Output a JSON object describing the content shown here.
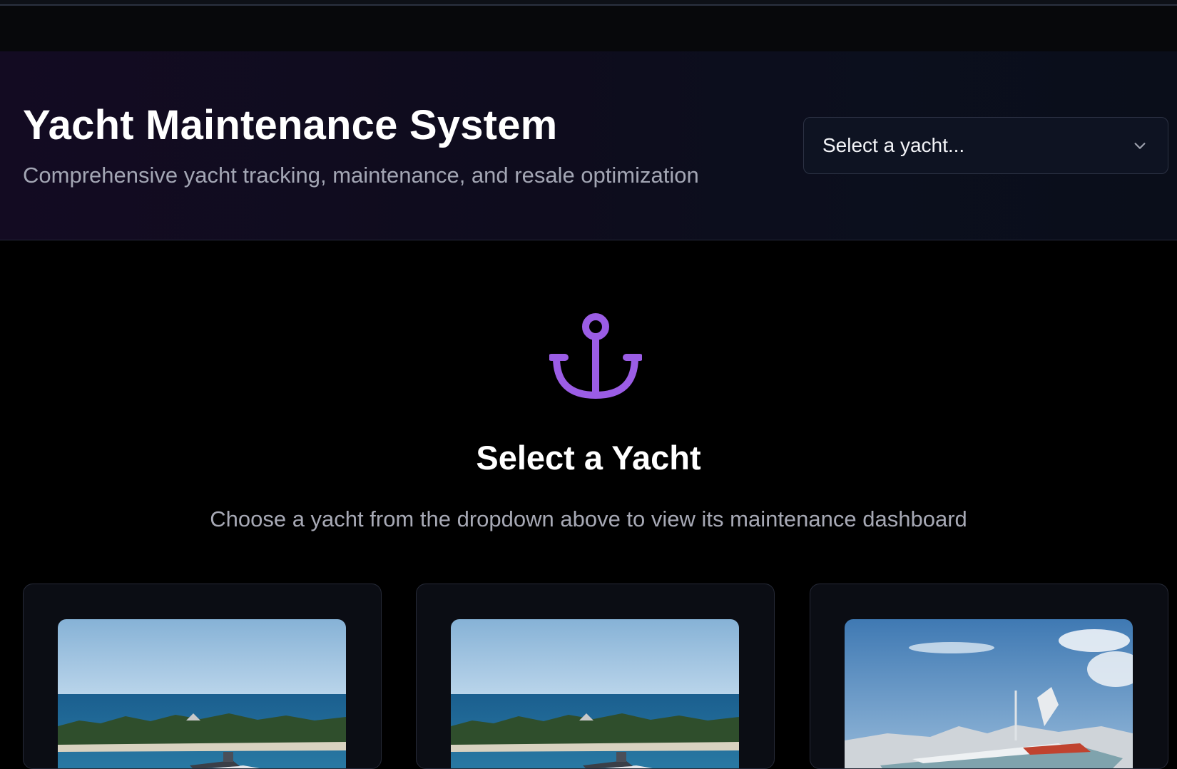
{
  "header": {
    "title": "Yacht Maintenance System",
    "subtitle": "Comprehensive yacht tracking, maintenance, and resale optimization"
  },
  "yacht_select": {
    "placeholder": "Select a yacht..."
  },
  "empty_state": {
    "icon": "anchor-icon",
    "heading": "Select a Yacht",
    "description": "Choose a yacht from the dropdown above to view its maintenance dashboard"
  },
  "yacht_cards": [
    {
      "image": "yacht-photo-island"
    },
    {
      "image": "yacht-photo-island"
    },
    {
      "image": "yacht-photo-marina"
    }
  ],
  "colors": {
    "accent": "#9b5de5",
    "background": "#000000",
    "header_bg": "#100c1f",
    "card_bg": "#0b0d14",
    "muted_text": "#a3a6b4"
  }
}
